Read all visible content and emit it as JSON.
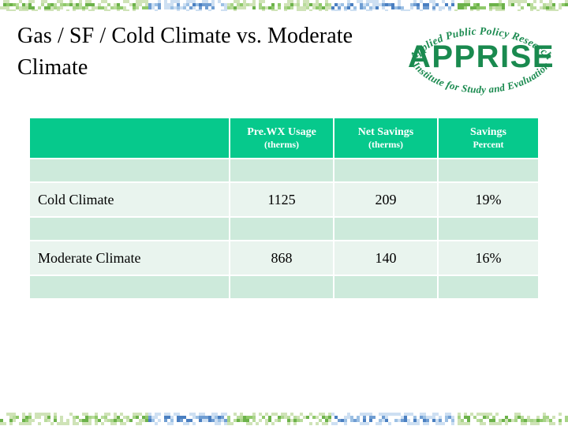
{
  "slide": {
    "title": "Gas / SF / Cold Climate vs. Moderate Climate"
  },
  "logo": {
    "name": "apprise-logo",
    "wordmark": "APPRISE",
    "arc_top": "Applied Public Policy Research",
    "arc_bottom": "Institute for Study and Evaluation",
    "color": "#1a8a4f"
  },
  "colors": {
    "header_green": "#06c98c",
    "spacer_mint": "#cdeadb",
    "row_mint": "#e9f4ee",
    "mosaic_green": "#6cb24a",
    "mosaic_blue": "#4a7fc1",
    "mosaic_pale": "#cfe3b7"
  },
  "table": {
    "name": "climate-comparison-table",
    "columns": [
      {
        "label": "",
        "sub": ""
      },
      {
        "label": "Pre.WX Usage",
        "sub": "(therms)"
      },
      {
        "label": "Net Savings",
        "sub": "(therms)"
      },
      {
        "label": "Savings",
        "sub": "Percent"
      }
    ],
    "rows": [
      {
        "label": "Cold Climate",
        "pre_wx_usage": "1125",
        "net_savings": "209",
        "savings_percent": "19%"
      },
      {
        "label": "Moderate Climate",
        "pre_wx_usage": "868",
        "net_savings": "140",
        "savings_percent": "16%"
      }
    ]
  }
}
